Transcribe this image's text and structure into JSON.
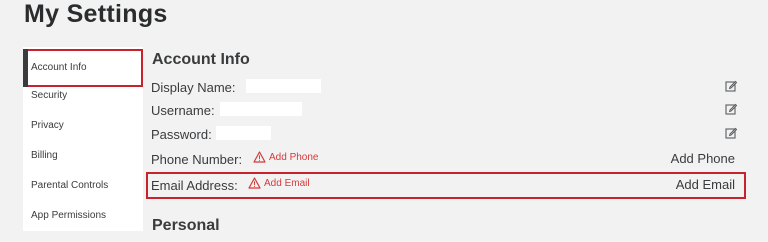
{
  "page": {
    "title": "My Settings"
  },
  "sidebar": {
    "items": [
      {
        "label": "Account Info",
        "active": true
      },
      {
        "label": "Security"
      },
      {
        "label": "Privacy"
      },
      {
        "label": "Billing"
      },
      {
        "label": "Parental Controls"
      },
      {
        "label": "App Permissions"
      }
    ]
  },
  "account_info": {
    "title": "Account Info",
    "display_name_label": "Display Name:",
    "username_label": "Username:",
    "password_label": "Password:",
    "phone_label": "Phone Number:",
    "phone_warning": "Add Phone",
    "phone_action": "Add Phone",
    "email_label": "Email Address:",
    "email_warning": "Add Email",
    "email_action": "Add Email"
  },
  "personal": {
    "title": "Personal"
  },
  "colors": {
    "accent_red": "#c8232c",
    "warning_red": "#d63a3a",
    "background": "#f2f2f2"
  },
  "icons": {
    "edit": "pencil-square-icon",
    "warning": "warning-triangle-icon"
  }
}
